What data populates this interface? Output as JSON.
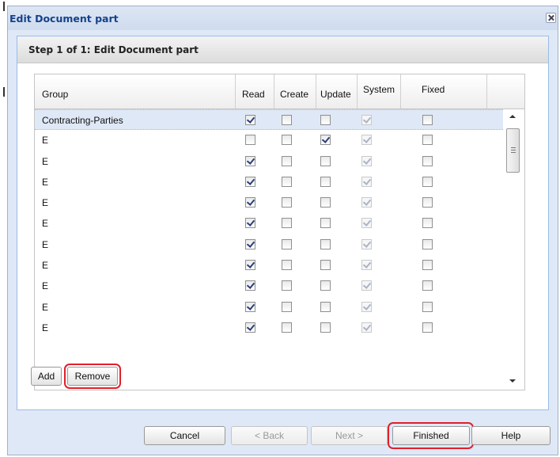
{
  "dialog": {
    "title": "Edit Document part"
  },
  "panel": {
    "title": "Step 1 of 1: Edit Document part"
  },
  "grid": {
    "columns": [
      "Group",
      "Read",
      "Create",
      "Update",
      "System",
      "Fixed"
    ],
    "rows": [
      {
        "group": "Contracting-Parties",
        "read": true,
        "create": false,
        "update": false,
        "system": true,
        "fixed": false,
        "selected": true
      },
      {
        "group": "E",
        "read": false,
        "create": false,
        "update": true,
        "system": true,
        "fixed": false
      },
      {
        "group": "E",
        "read": true,
        "create": false,
        "update": false,
        "system": true,
        "fixed": false
      },
      {
        "group": "E",
        "read": true,
        "create": false,
        "update": false,
        "system": true,
        "fixed": false
      },
      {
        "group": "E",
        "read": true,
        "create": false,
        "update": false,
        "system": true,
        "fixed": false
      },
      {
        "group": "E",
        "read": true,
        "create": false,
        "update": false,
        "system": true,
        "fixed": false
      },
      {
        "group": "E",
        "read": true,
        "create": false,
        "update": false,
        "system": true,
        "fixed": false
      },
      {
        "group": "E",
        "read": true,
        "create": false,
        "update": false,
        "system": true,
        "fixed": false
      },
      {
        "group": "E",
        "read": true,
        "create": false,
        "update": false,
        "system": true,
        "fixed": false
      },
      {
        "group": "E",
        "read": true,
        "create": false,
        "update": false,
        "system": true,
        "fixed": false
      },
      {
        "group": "E",
        "read": true,
        "create": false,
        "update": false,
        "system": true,
        "fixed": false
      }
    ]
  },
  "actions": {
    "add_label": "Add",
    "remove_label": "Remove"
  },
  "footer": {
    "cancel_label": "Cancel",
    "back_label": "< Back",
    "next_label": "Next >",
    "finished_label": "Finished",
    "help_label": "Help"
  },
  "colors": {
    "title_text": "#15428b",
    "highlight": "#e0202a",
    "dialog_bg": "#dfe8f6"
  }
}
